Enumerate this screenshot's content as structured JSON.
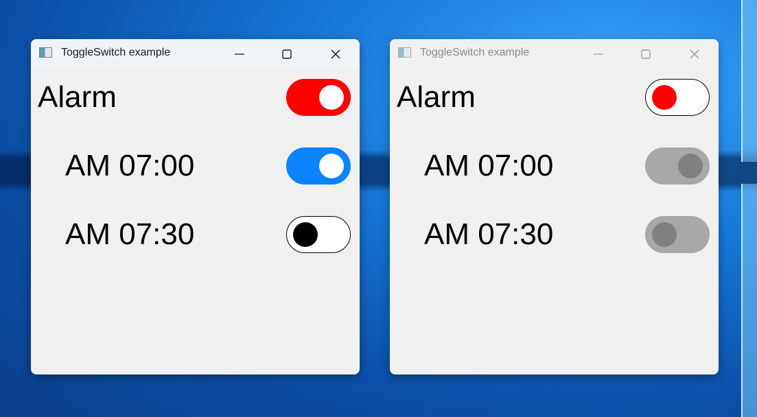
{
  "windows": [
    {
      "title": "ToggleSwitch example",
      "state": "active",
      "rows": [
        {
          "label": "Alarm",
          "checked": true,
          "track": "#ff0000",
          "knob": "#ffffff",
          "border": "#ff0000"
        },
        {
          "label": "AM 07:00",
          "checked": true,
          "track": "#0a84ff",
          "knob": "#ffffff",
          "border": "#0a84ff"
        },
        {
          "label": "AM 07:30",
          "checked": false,
          "track": "#ffffff",
          "knob": "#000000",
          "border": "#000000"
        }
      ]
    },
    {
      "title": "ToggleSwitch example",
      "state": "inactive",
      "rows": [
        {
          "label": "Alarm",
          "checked": false,
          "track": "#ffffff",
          "knob": "#ff0000",
          "border": "#000000"
        },
        {
          "label": "AM 07:00",
          "checked": true,
          "track": "#a8a8a8",
          "knob": "#808080",
          "border": "#a8a8a8"
        },
        {
          "label": "AM 07:30",
          "checked": false,
          "track": "#a8a8a8",
          "knob": "#808080",
          "border": "#a8a8a8"
        }
      ]
    }
  ],
  "icons": {
    "app": "app-window-icon",
    "minimize": "minimize-icon",
    "maximize": "maximize-icon",
    "close": "close-icon"
  }
}
